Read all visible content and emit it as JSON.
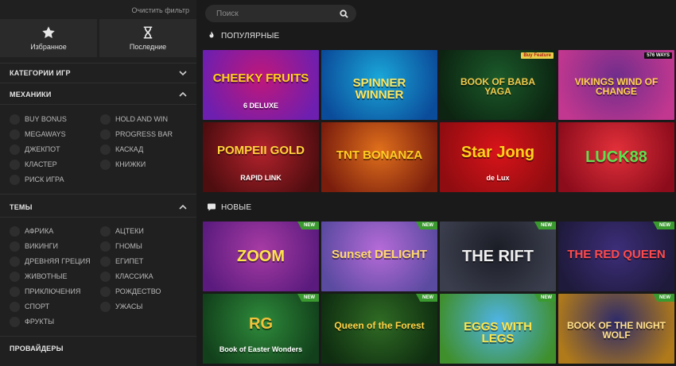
{
  "sidebar": {
    "clear_filter": "Очистить фильтр",
    "quick": [
      {
        "label": "Избранное",
        "icon": "star-icon"
      },
      {
        "label": "Последние",
        "icon": "hourglass-icon"
      }
    ],
    "categories_title": "КАТЕГОРИИ ИГР",
    "mechanics_title": "МЕХАНИКИ",
    "mechanics": [
      "BUY BONUS",
      "HOLD AND WIN",
      "MEGAWAYS",
      "PROGRESS BAR",
      "ДЖЕКПОТ",
      "КАСКАД",
      "КЛАСТЕР",
      "КНИЖКИ",
      "РИСК ИГРА"
    ],
    "themes_title": "ТЕМЫ",
    "themes": [
      "АФРИКА",
      "АЦТЕКИ",
      "ВИКИНГИ",
      "ГНОМЫ",
      "ДРЕВНЯЯ ГРЕЦИЯ",
      "ЕГИПЕТ",
      "ЖИВОТНЫЕ",
      "КЛАССИКА",
      "ПРИКЛЮЧЕНИЯ",
      "РОЖДЕСТВО",
      "СПОРТ",
      "УЖАСЫ",
      "ФРУКТЫ"
    ],
    "providers_title": "ПРОВАЙДЕРЫ"
  },
  "search": {
    "placeholder": "Поиск"
  },
  "popular": {
    "title": "ПОПУЛЯРНЫЕ",
    "games": [
      {
        "name": "CHEEKY FRUITS",
        "sub": "6 DELUXE",
        "bg": "#c0177a",
        "bg2": "#6d1fb0",
        "color": "#ffd21a"
      },
      {
        "name": "SPINNER WINNER",
        "sub": "",
        "bg": "#1aa7d8",
        "bg2": "#0b4c9a",
        "color": "#ffe45a"
      },
      {
        "name": "BOOK OF BABA YAGA",
        "sub": "",
        "bg": "#1b5a2a",
        "bg2": "#0c2411",
        "color": "#f2c94c",
        "corner": "Buy Feature"
      },
      {
        "name": "VIKINGS WIND OF CHANGE",
        "sub": "",
        "bg": "#6f2d8c",
        "bg2": "#c2378f",
        "color": "#ffd54a",
        "corner": "576 WAYS"
      },
      {
        "name": "POMPEII GOLD",
        "sub": "RAPID LINK",
        "bg": "#b3222c",
        "bg2": "#4e0d0f",
        "color": "#ffd33a"
      },
      {
        "name": "TNT BONANZA",
        "sub": "",
        "bg": "#e0701c",
        "bg2": "#7a1d0d",
        "color": "#ffcc22"
      },
      {
        "name": "Star Jong",
        "sub": "de Lux",
        "bg": "#d8141a",
        "bg2": "#8f0c10",
        "color": "#ffd21a"
      },
      {
        "name": "LUCK88",
        "sub": "",
        "bg": "#e2303a",
        "bg2": "#8d0c1c",
        "color": "#5fe04e"
      }
    ]
  },
  "new_games": {
    "title": "НОВЫЕ",
    "badge": "NEW",
    "games": [
      {
        "name": "ZOOM",
        "sub": "",
        "bg": "#a73ba4",
        "bg2": "#5b1b7e",
        "color": "#ffe44a"
      },
      {
        "name": "Sunset DELIGHT",
        "sub": "",
        "bg": "#b66bd8",
        "bg2": "#5a4aa0",
        "color": "#ffd86a"
      },
      {
        "name": "THE RIFT",
        "sub": "",
        "bg": "#1b1d26",
        "bg2": "#3b3e4d",
        "color": "#f0f0f0"
      },
      {
        "name": "THE RED QUEEN",
        "sub": "",
        "bg": "#3d2e7a",
        "bg2": "#1e1a3b",
        "color": "#ff4a4a"
      },
      {
        "name": "RG",
        "sub": "Book of Easter Wonders",
        "bg": "#2e8b3b",
        "bg2": "#12401b",
        "color": "#f3c23a"
      },
      {
        "name": "Queen of the Forest",
        "sub": "",
        "bg": "#2f6b24",
        "bg2": "#0f2d10",
        "color": "#ffcf45"
      },
      {
        "name": "EGGS WITH LEGS",
        "sub": "",
        "bg": "#4fb4e6",
        "bg2": "#3f8f2d",
        "color": "#ffe44a"
      },
      {
        "name": "BOOK OF THE NIGHT WOLF",
        "sub": "",
        "bg": "#2c2a6a",
        "bg2": "#b07a1a",
        "color": "#ffe08a"
      }
    ]
  }
}
